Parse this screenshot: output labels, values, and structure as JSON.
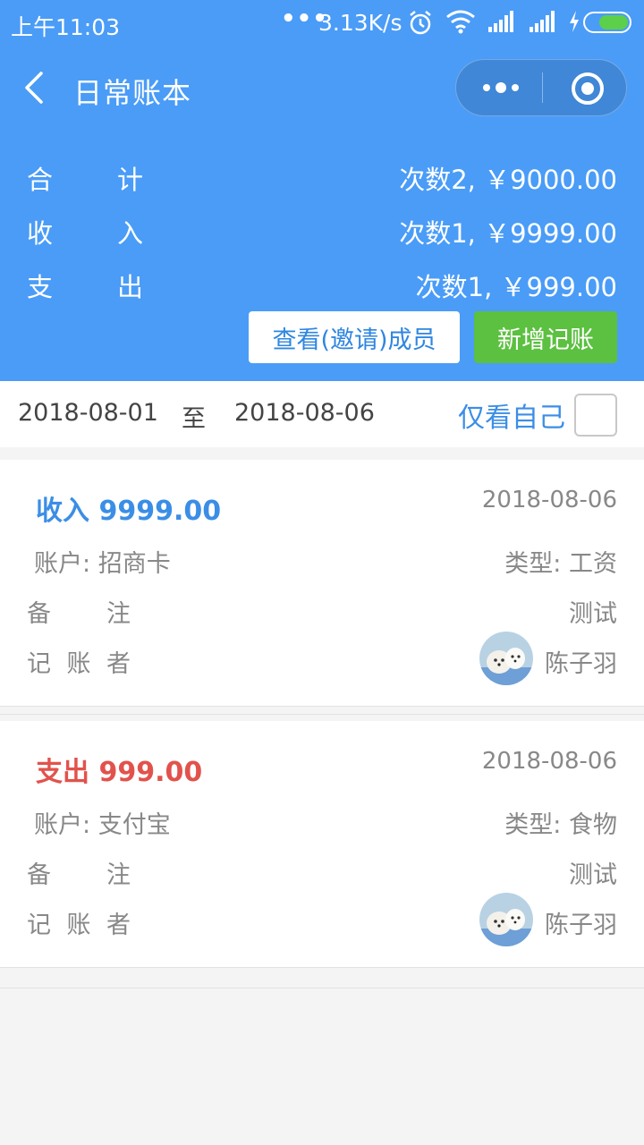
{
  "status_bar": {
    "time": "上午11:03",
    "dots": "•••",
    "speed": "3.13K/s",
    "icons": [
      "alarm-icon",
      "wifi-icon",
      "signal-icon",
      "signal-icon",
      "charging-icon",
      "battery-icon"
    ]
  },
  "nav": {
    "title": "日常账本"
  },
  "summary": [
    {
      "label": [
        "合",
        "计"
      ],
      "value": "次数2, ￥9000.00"
    },
    {
      "label": [
        "收",
        "入"
      ],
      "value": "次数1, ￥9999.00"
    },
    {
      "label": [
        "支",
        "出"
      ],
      "value": "次数1, ￥999.00"
    }
  ],
  "buttons": {
    "invite": "查看(邀请)成员",
    "add": "新增记账"
  },
  "filter": {
    "start": "2018-08-01",
    "to": "至",
    "end": "2018-08-06",
    "only_self": "仅看自己",
    "only_self_checked": false
  },
  "records": [
    {
      "kind": "收入",
      "amount": "9999.00",
      "date": "2018-08-06",
      "account_label": "账户:",
      "account": "招商卡",
      "type_label": "类型:",
      "type": "工资",
      "note_label": [
        "备",
        "注"
      ],
      "note": "测试",
      "recorder_label": [
        "记",
        "账",
        "者"
      ],
      "recorder": "陈子羽"
    },
    {
      "kind": "支出",
      "amount": "999.00",
      "date": "2018-08-06",
      "account_label": "账户:",
      "account": "支付宝",
      "type_label": "类型:",
      "type": "食物",
      "note_label": [
        "备",
        "注"
      ],
      "note": "测试",
      "recorder_label": [
        "记",
        "账",
        "者"
      ],
      "recorder": "陈子羽"
    }
  ],
  "colors": {
    "header": "#4a9cf7",
    "income": "#3b8ee6",
    "expense": "#e2524c",
    "add_button": "#5cc040"
  }
}
